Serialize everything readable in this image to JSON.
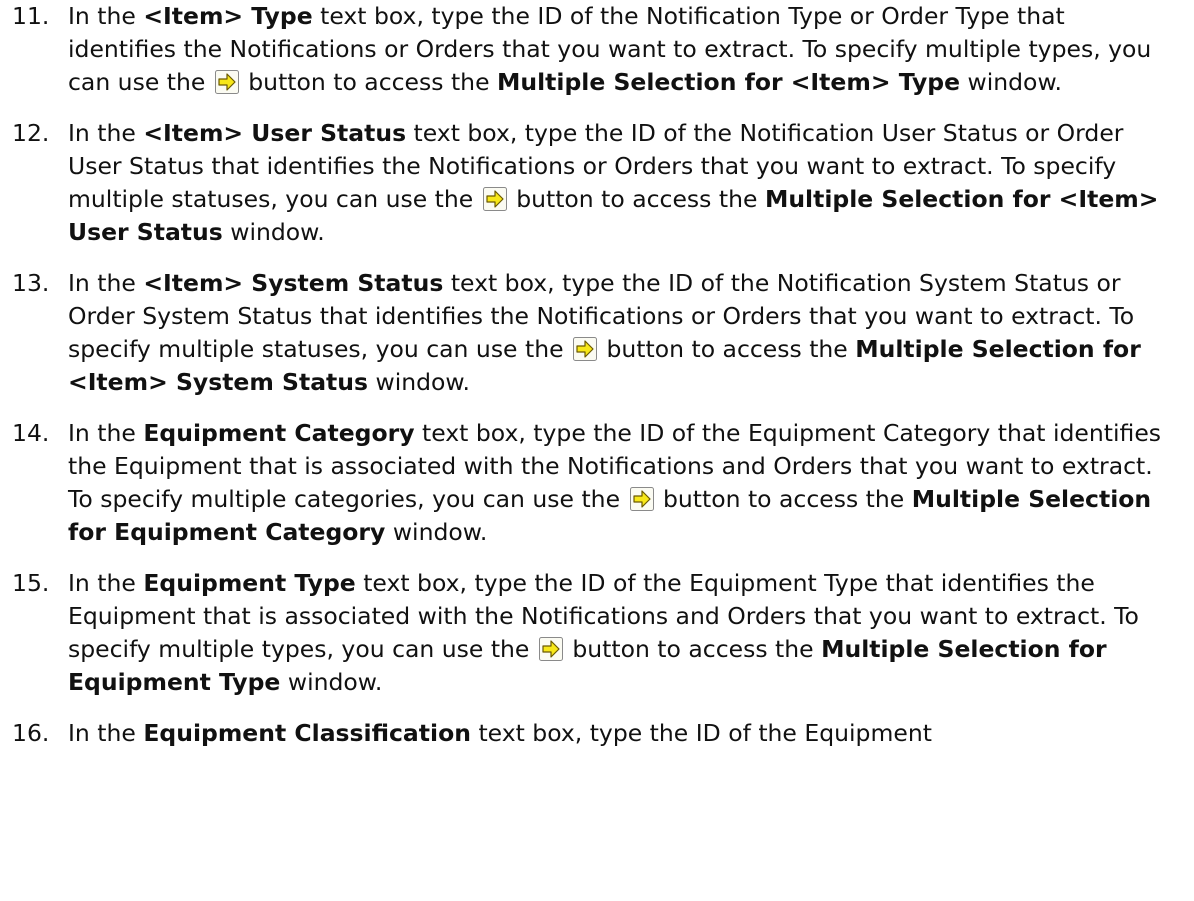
{
  "steps": [
    {
      "number": "11.",
      "parts": [
        {
          "t": "In the "
        },
        {
          "t": "<Item> Type",
          "b": true
        },
        {
          "t": " text box, type the ID of the Notification Type or Order Type that identifies the Notifications or Orders that you want to extract. To specify multiple types, you can use the "
        },
        {
          "icon": "multiple-selection-arrow-icon"
        },
        {
          "t": " button to access the "
        },
        {
          "t": "Multiple Selection for <Item> Type",
          "b": true
        },
        {
          "t": " window."
        }
      ]
    },
    {
      "number": "12.",
      "parts": [
        {
          "t": "In the "
        },
        {
          "t": "<Item> User Status",
          "b": true
        },
        {
          "t": " text box, type the ID of the Notification User Status or Order User Status that identifies the Notifications or Orders that you want to extract. To specify multiple statuses, you can use the "
        },
        {
          "icon": "multiple-selection-arrow-icon"
        },
        {
          "t": " button to access the "
        },
        {
          "t": "Multiple Selection for <Item> User Status",
          "b": true
        },
        {
          "t": " window."
        }
      ]
    },
    {
      "number": "13.",
      "parts": [
        {
          "t": "In the "
        },
        {
          "t": "<Item> System Status",
          "b": true
        },
        {
          "t": " text box, type the ID of the Notification System Status or Order System Status that identifies the Notifications or Orders that you want to extract. To specify multiple statuses, you can use the "
        },
        {
          "icon": "multiple-selection-arrow-icon"
        },
        {
          "t": " button to access the "
        },
        {
          "t": "Multiple Selection for <Item> System Status",
          "b": true
        },
        {
          "t": " window."
        }
      ]
    },
    {
      "number": "14.",
      "parts": [
        {
          "t": "In the "
        },
        {
          "t": "Equipment Category",
          "b": true
        },
        {
          "t": " text box, type the ID of the Equipment Category that identifies the Equipment that is associated with the Notifications and Orders that you want to extract. To specify multiple categories, you can use the "
        },
        {
          "icon": "multiple-selection-arrow-icon"
        },
        {
          "t": " button to access the "
        },
        {
          "t": "Multiple Selection for Equipment Category",
          "b": true
        },
        {
          "t": " window."
        }
      ]
    },
    {
      "number": "15.",
      "parts": [
        {
          "t": "In the "
        },
        {
          "t": "Equipment Type",
          "b": true
        },
        {
          "t": " text box, type the ID of the Equipment Type that identifies the Equipment that is associated with the Notifications and Orders that you want to extract. To specify multiple types, you can use the "
        },
        {
          "icon": "multiple-selection-arrow-icon"
        },
        {
          "t": " button to access the "
        },
        {
          "t": "Multiple Selection for Equipment Type",
          "b": true
        },
        {
          "t": " window."
        }
      ]
    },
    {
      "number": "16.",
      "parts": [
        {
          "t": "In the "
        },
        {
          "t": "Equipment Classification",
          "b": true
        },
        {
          "t": " text box, type the ID of the Equipment"
        }
      ]
    }
  ],
  "colors": {
    "icon_fill": "#f7e718",
    "icon_border": "#8a8a8a",
    "icon_face": "#fbfbf2",
    "text": "#111111"
  }
}
